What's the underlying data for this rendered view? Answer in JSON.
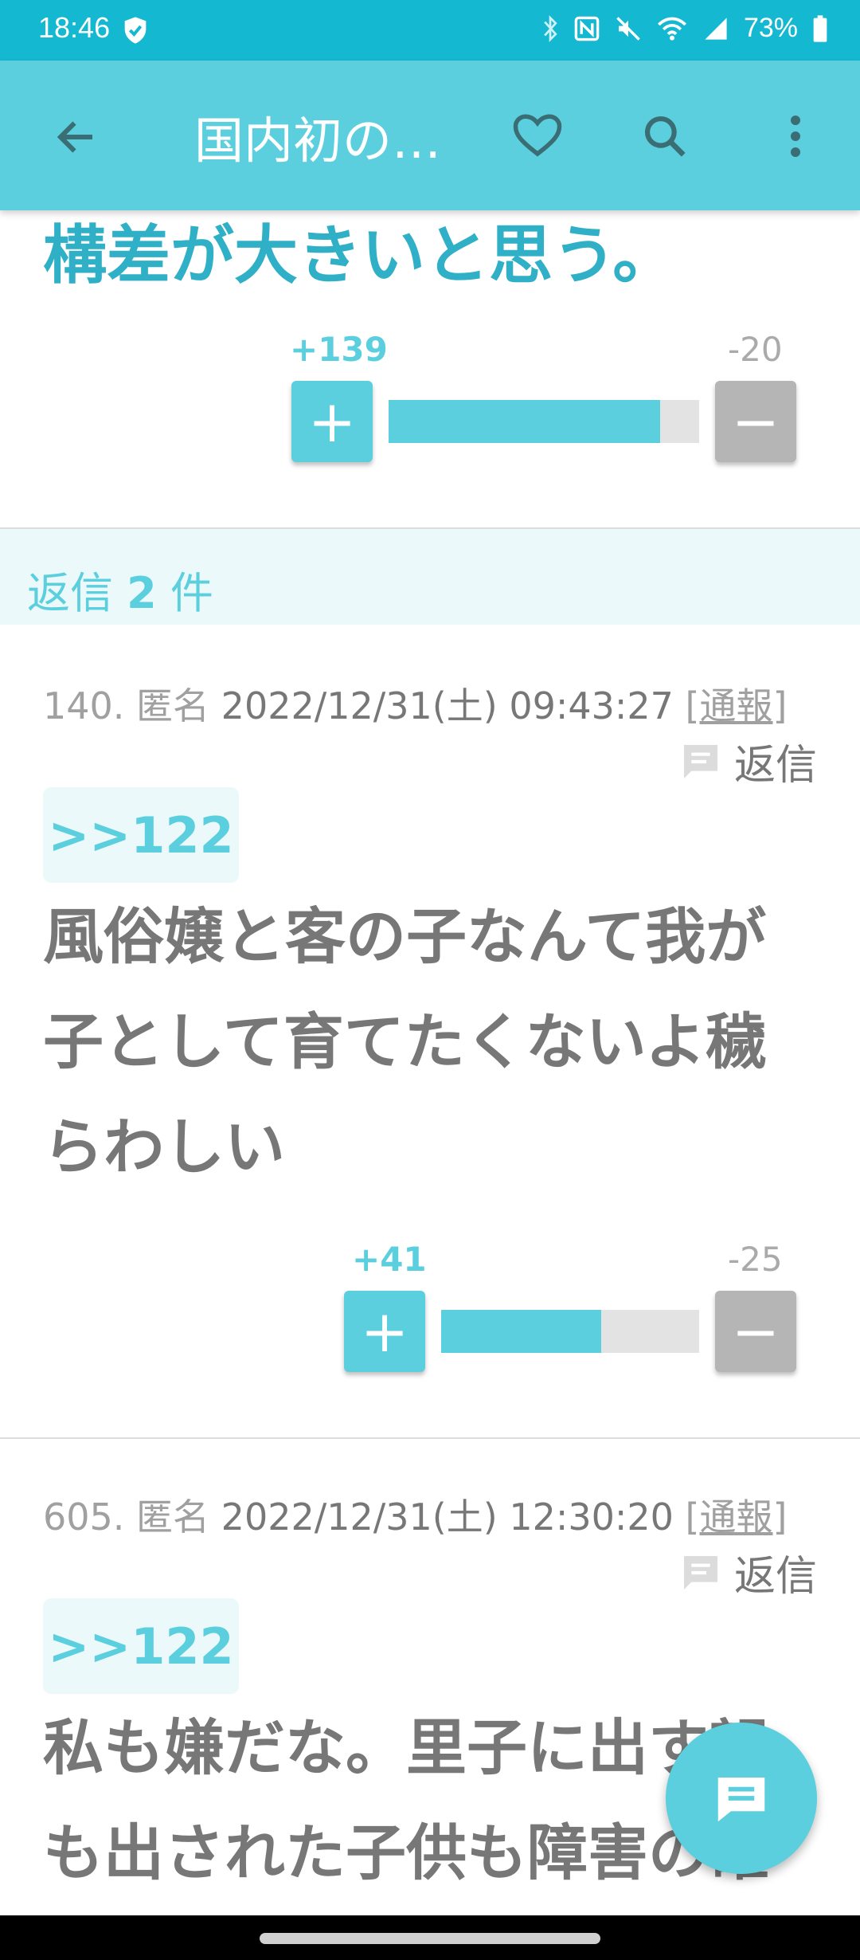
{
  "status_bar": {
    "time": "18:46",
    "battery_percent": "73%"
  },
  "app_bar": {
    "title": "国内初の…",
    "icons": [
      "back-arrow-icon",
      "heart-icon",
      "search-icon",
      "more-vert-icon"
    ]
  },
  "main_comment": {
    "text_tail": "構差が大きいと思う。",
    "plus": "+139",
    "minus": "-20",
    "ratio": 0.874
  },
  "replies": {
    "label": "返信",
    "count": "2",
    "unit": "件",
    "items": [
      {
        "num": "140.",
        "author": "匿名",
        "date": "2022/12/31(土) 09:43:27",
        "report_open": "[",
        "report": "通報",
        "report_close": "]",
        "reply_label": "返信",
        "anchor": ">>122",
        "body": "風俗嬢と客の子なんて我が子として育てたくないよ穢らわしい",
        "plus": "+41",
        "minus": "-25",
        "ratio": 0.621
      },
      {
        "num": "605.",
        "author": "匿名",
        "date": "2022/12/31(土) 12:30:20",
        "report_open": "[",
        "report": "通報",
        "report_close": "]",
        "reply_label": "返信",
        "anchor": ">>122",
        "body": "私も嫌だな。里子に出す親も出された子供も障害の確"
      }
    ]
  },
  "colors": {
    "accent": "#5ccfde",
    "status_bar": "#14b8d0",
    "minus_button": "#b5b5b5",
    "body_text": "#777777"
  }
}
